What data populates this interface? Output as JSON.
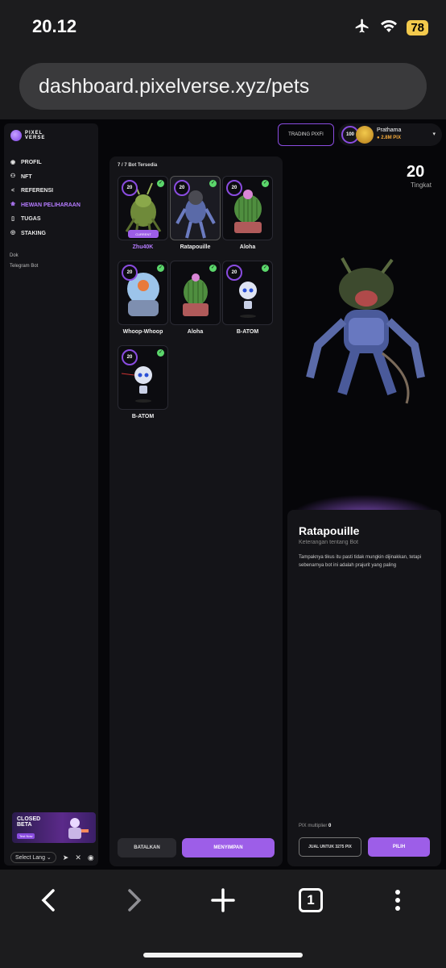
{
  "status": {
    "time": "20.12",
    "battery": "78"
  },
  "browser": {
    "url": "dashboard.pixelverse.xyz/pets",
    "tab_count": "1"
  },
  "brand": {
    "line1": "PIXEL",
    "line2": "VERSE"
  },
  "sidebar": {
    "items": [
      {
        "label": "PROFIL",
        "icon": "user-circle-icon"
      },
      {
        "label": "NFT",
        "icon": "users-icon"
      },
      {
        "label": "REFERENSI",
        "icon": "share-icon"
      },
      {
        "label": "HEWAN PELIHARAAN",
        "icon": "paw-icon",
        "active": true
      },
      {
        "label": "TUGAS",
        "icon": "clipboard-icon"
      },
      {
        "label": "STAKING",
        "icon": "coin-icon"
      }
    ],
    "links": [
      "Dok",
      "Telegram Bot"
    ],
    "beta": {
      "title_line1": "CLOSED",
      "title_line2": "BETA",
      "button": "Test Now"
    },
    "language": "Select Lang"
  },
  "header": {
    "trading_button": "TRADING PIXFI",
    "profile": {
      "level": "100",
      "name": "Prathama",
      "pix": "2.8M PIX"
    }
  },
  "pets_panel": {
    "count_label": "7 / 7 Bot Tersedia",
    "cards": [
      {
        "name": "Zhu40K",
        "level": "20",
        "current": true,
        "current_label": "CURRENT"
      },
      {
        "name": "Ratapouille",
        "level": "20",
        "selected": true
      },
      {
        "name": "Aloha",
        "level": "20"
      },
      {
        "name": "Whoop-Whoop",
        "level": "20"
      },
      {
        "name": "Aloha",
        "level": ""
      },
      {
        "name": "B-ATOM",
        "level": "20"
      },
      {
        "name": "B-ATOM",
        "level": "20"
      }
    ],
    "cancel_button": "BATALKAN",
    "save_button": "MENYIMPAN"
  },
  "detail": {
    "level": "20",
    "level_label": "Tingkat",
    "name": "Ratapouille",
    "subtitle": "Keterangan tentang Bot",
    "description": "Tampaknya tikus itu pasti tidak mungkin dijinakkan, tetapi sebenarnya bot ini adalah prajurit yang paling",
    "multiplier_label": "PIX multiplier",
    "multiplier_value": "0",
    "sell_button": "JUAL UNTUK 3275 PIX",
    "pick_button": "PILIH"
  },
  "colors": {
    "accent": "#9d5ee8",
    "background": "#060609",
    "panel": "#141418",
    "check": "#5bd66b",
    "pix": "#f2a93b"
  }
}
